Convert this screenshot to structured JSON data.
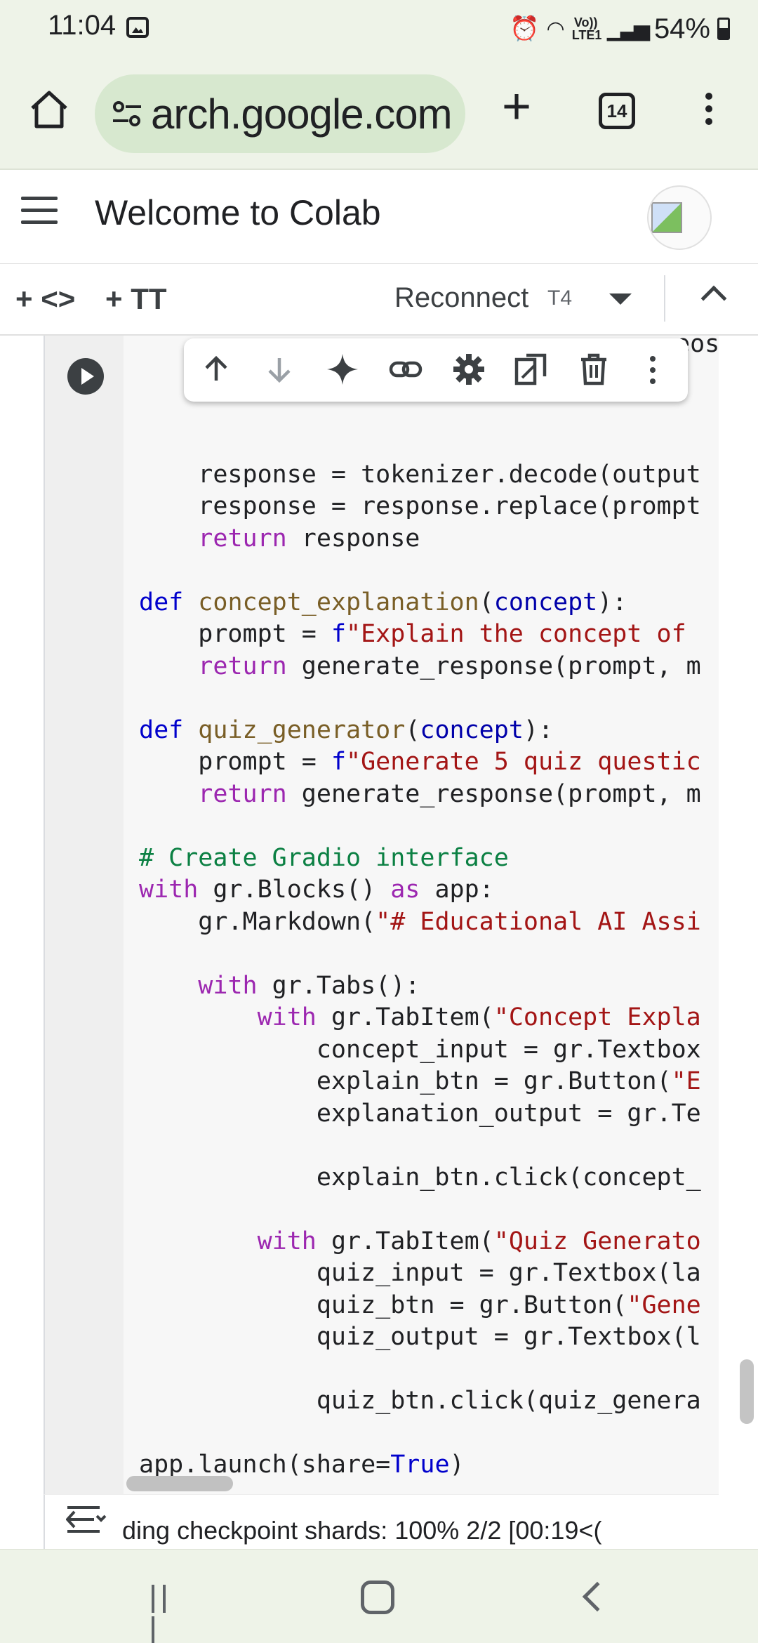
{
  "status_bar": {
    "time": "11:04",
    "network": "Vo)) LTE1",
    "battery": "54%"
  },
  "browser": {
    "url": "arch.google.com",
    "tab_count": "14"
  },
  "colab": {
    "title": "Welcome to Colab",
    "toolbar": {
      "add_code": "+ <>",
      "add_text": "+ TT",
      "reconnect": "Reconnect",
      "runtime": "T4"
    }
  },
  "cell": {
    "top_fragment": "eos",
    "code_lines": [
      "    response = tokenizer.decode(output",
      "    response = response.replace(prompt",
      "    return response",
      "",
      "def concept_explanation(concept):",
      "    prompt = f\"Explain the concept of",
      "    return generate_response(prompt, m",
      "",
      "def quiz_generator(concept):",
      "    prompt = f\"Generate 5 quiz questic",
      "    return generate_response(prompt, m",
      "",
      "# Create Gradio interface",
      "with gr.Blocks() as app:",
      "    gr.Markdown(\"# Educational AI Assi",
      "",
      "    with gr.Tabs():",
      "        with gr.TabItem(\"Concept Expla",
      "            concept_input = gr.Textbox",
      "            explain_btn = gr.Button(\"E",
      "            explanation_output = gr.Te",
      "",
      "            explain_btn.click(concept_",
      "",
      "        with gr.TabItem(\"Quiz Generato",
      "            quiz_input = gr.Textbox(la",
      "            quiz_btn = gr.Button(\"Gene",
      "            quiz_output = gr.Textbox(l",
      "",
      "            quiz_btn.click(quiz_genera",
      "",
      "app.launch(share=True)"
    ],
    "output_text": "ding checkpoint shards: 100%   2/2 [00:19<("
  },
  "icons": [
    "home-icon",
    "tune-icon",
    "plus-icon",
    "kebab-icon",
    "hamburger-icon",
    "run-icon",
    "arrow-up-icon",
    "arrow-down-icon",
    "sparkle-icon",
    "link-icon",
    "gear-icon",
    "mirror-icon",
    "trash-icon",
    "output-toggle-icon"
  ]
}
